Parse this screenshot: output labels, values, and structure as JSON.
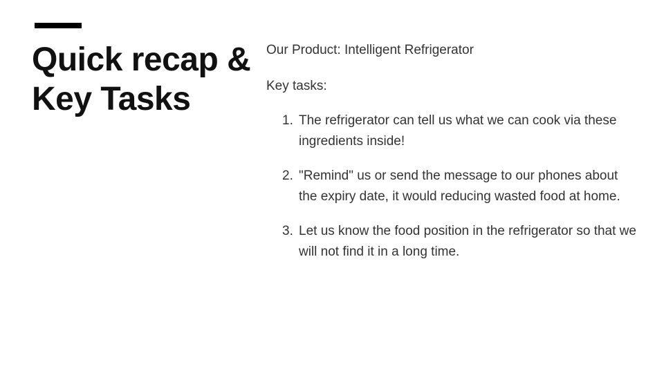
{
  "slide": {
    "title_line1": "Quick recap &",
    "title_line2": "Key Tasks",
    "product_line": "Our Product: Intelligent Refrigerator",
    "tasks_heading": "Key tasks:",
    "tasks": [
      {
        "number": "1.",
        "text": "The refrigerator can tell us what we can cook via these ingredients inside!"
      },
      {
        "number": "2.",
        "text": "\"Remind\" us or send the message to our phones about the expiry date, it would reducing wasted food at home."
      },
      {
        "number": "3.",
        "text": "Let us know the food position in the refrigerator so that we will not find it in a long time."
      }
    ]
  }
}
